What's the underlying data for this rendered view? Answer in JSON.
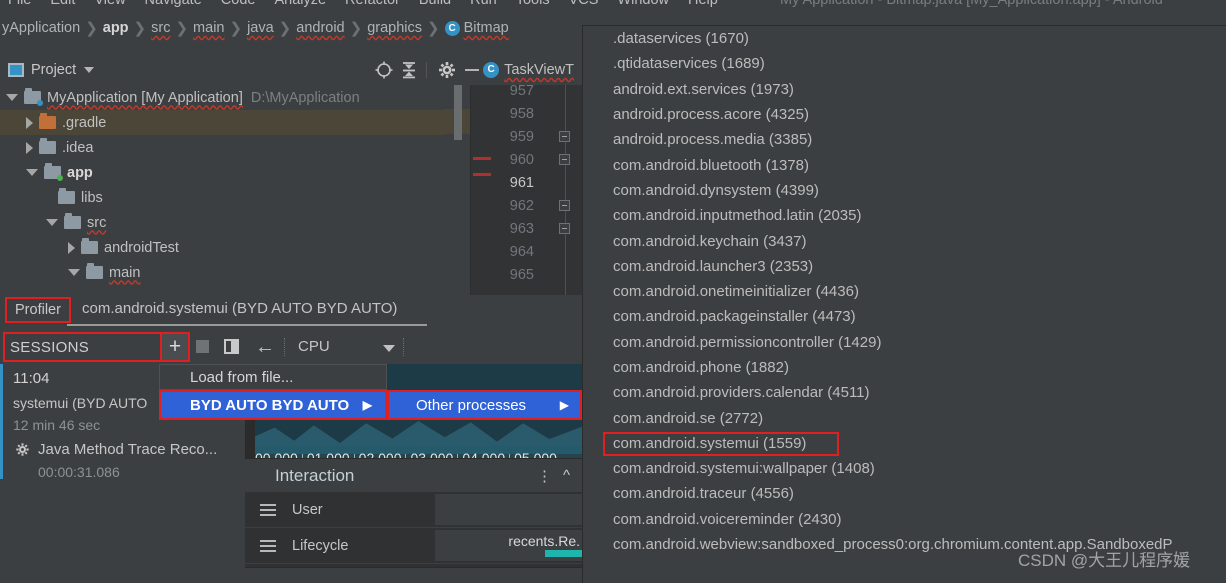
{
  "window": {
    "title": "My Application - Bitmap.java [My_Application.app] - Android"
  },
  "menubar": {
    "items": [
      "File",
      "Edit",
      "View",
      "Navigate",
      "Code",
      "Analyze",
      "Refactor",
      "Build",
      "Run",
      "Tools",
      "VCS",
      "Window",
      "Help"
    ]
  },
  "breadcrumb": {
    "items": [
      {
        "label": "yApplication",
        "bold": false,
        "wavy": false
      },
      {
        "label": "app",
        "bold": true,
        "wavy": false
      },
      {
        "label": "src",
        "bold": false,
        "wavy": true
      },
      {
        "label": "main",
        "bold": false,
        "wavy": true
      },
      {
        "label": "java",
        "bold": false,
        "wavy": true
      },
      {
        "label": "android",
        "bold": false,
        "wavy": true
      },
      {
        "label": "graphics",
        "bold": false,
        "wavy": true
      },
      {
        "label": "Bitmap",
        "bold": false,
        "wavy": true,
        "icon": "class-c-icon"
      }
    ],
    "separator": "❯"
  },
  "project_panel": {
    "title": "Project",
    "icons": [
      "locate-icon",
      "collapse-all-icon",
      "gear-icon",
      "minimize-icon"
    ],
    "editor_tab": {
      "badge": "C",
      "label": "TaskViewT"
    },
    "tree": [
      {
        "name": "MyApplication [My Application]",
        "path": "D:\\MyApplication",
        "indent": 0,
        "twisty": "expanded",
        "icon": "module-folder-icon",
        "bold_part": "[My Application]",
        "selected": false
      },
      {
        "name": ".gradle",
        "path": "",
        "indent": 1,
        "twisty": "collapsed",
        "icon": "folder-orange-icon",
        "selected": true
      },
      {
        "name": ".idea",
        "path": "",
        "indent": 1,
        "twisty": "collapsed",
        "icon": "folder-icon",
        "selected": false
      },
      {
        "name": "app",
        "path": "",
        "indent": 1,
        "twisty": "expanded",
        "icon": "module-folder-icon",
        "bold": true,
        "selected": false
      },
      {
        "name": "libs",
        "path": "",
        "indent": 2,
        "twisty": "none",
        "icon": "folder-icon",
        "selected": false
      },
      {
        "name": "src",
        "path": "",
        "indent": 2,
        "twisty": "expanded",
        "icon": "folder-icon",
        "selected": false
      },
      {
        "name": "androidTest",
        "path": "",
        "indent": 3,
        "twisty": "collapsed",
        "icon": "folder-icon",
        "selected": false
      },
      {
        "name": "main",
        "path": "",
        "indent": 3,
        "twisty": "expanded",
        "icon": "folder-icon",
        "selected": false
      }
    ]
  },
  "editor_gutter": {
    "line_numbers": [
      "957",
      "958",
      "959",
      "960",
      "961",
      "962",
      "963",
      "964",
      "965"
    ],
    "current_line": "961"
  },
  "profiler": {
    "tab_label": "Profiler",
    "process_title": "com.android.systemui (BYD AUTO BYD AUTO)",
    "sessions_label": "SESSIONS",
    "add_button": "+",
    "stop_button": "stop-icon",
    "split_button": "split-view-icon",
    "back_button": "←",
    "view_selector": "CPU",
    "session": {
      "time": "11:04",
      "name": "systemui (BYD AUTO",
      "duration": "12 min 46 sec",
      "trace_label": "Java Method Trace Reco...",
      "trace_duration": "00:00:31.086"
    },
    "timeline_ticks": [
      "00.000",
      "01.000",
      "02.000",
      "03.000",
      "04.000",
      "05.000"
    ],
    "interaction": {
      "title": "Interaction",
      "rows": [
        {
          "label": "User",
          "event": "",
          "has_bar": false
        },
        {
          "label": "Lifecycle",
          "event": "recents.Re.",
          "has_bar": true
        }
      ]
    }
  },
  "context_menu": {
    "items": [
      {
        "label": "Load from file...",
        "highlighted": false,
        "has_submenu": false,
        "boxed": false
      },
      {
        "label": "BYD AUTO BYD AUTO",
        "highlighted": true,
        "has_submenu": true,
        "boxed": true
      }
    ],
    "submenu": [
      {
        "label": "Other processes",
        "highlighted": true,
        "has_submenu": true,
        "boxed": true
      }
    ],
    "arrow": "▶"
  },
  "process_list": {
    "items": [
      {
        "label": ".dataservices (1670)",
        "highlighted": false
      },
      {
        "label": ".qtidataservices (1689)",
        "highlighted": false
      },
      {
        "label": "android.ext.services (1973)",
        "highlighted": false
      },
      {
        "label": "android.process.acore (4325)",
        "highlighted": false
      },
      {
        "label": "android.process.media (3385)",
        "highlighted": false
      },
      {
        "label": "com.android.bluetooth (1378)",
        "highlighted": false
      },
      {
        "label": "com.android.dynsystem (4399)",
        "highlighted": false
      },
      {
        "label": "com.android.inputmethod.latin (2035)",
        "highlighted": false
      },
      {
        "label": "com.android.keychain (3437)",
        "highlighted": false
      },
      {
        "label": "com.android.launcher3 (2353)",
        "highlighted": false
      },
      {
        "label": "com.android.onetimeinitializer (4436)",
        "highlighted": false
      },
      {
        "label": "com.android.packageinstaller (4473)",
        "highlighted": false
      },
      {
        "label": "com.android.permissioncontroller (1429)",
        "highlighted": false
      },
      {
        "label": "com.android.phone (1882)",
        "highlighted": false
      },
      {
        "label": "com.android.providers.calendar (4511)",
        "highlighted": false
      },
      {
        "label": "com.android.se (2772)",
        "highlighted": false
      },
      {
        "label": "com.android.systemui (1559)",
        "highlighted": true
      },
      {
        "label": "com.android.systemui:wallpaper (1408)",
        "highlighted": false
      },
      {
        "label": "com.android.traceur (4556)",
        "highlighted": false
      },
      {
        "label": "com.android.voicereminder (2430)",
        "highlighted": false
      },
      {
        "label": "com.android.webview:sandboxed_process0:org.chromium.content.app.SandboxedP",
        "highlighted": false
      }
    ]
  },
  "watermark": "CSDN @大王儿程序媛",
  "colors": {
    "background": "#3c3f41",
    "panel_dark": "#2b2b2b",
    "accent_blue": "#3592c4",
    "menu_highlight": "#2f62d6",
    "annotation_red": "#e02020",
    "teal_bar": "#1fb5ac",
    "selection_row": "#4b4638"
  }
}
